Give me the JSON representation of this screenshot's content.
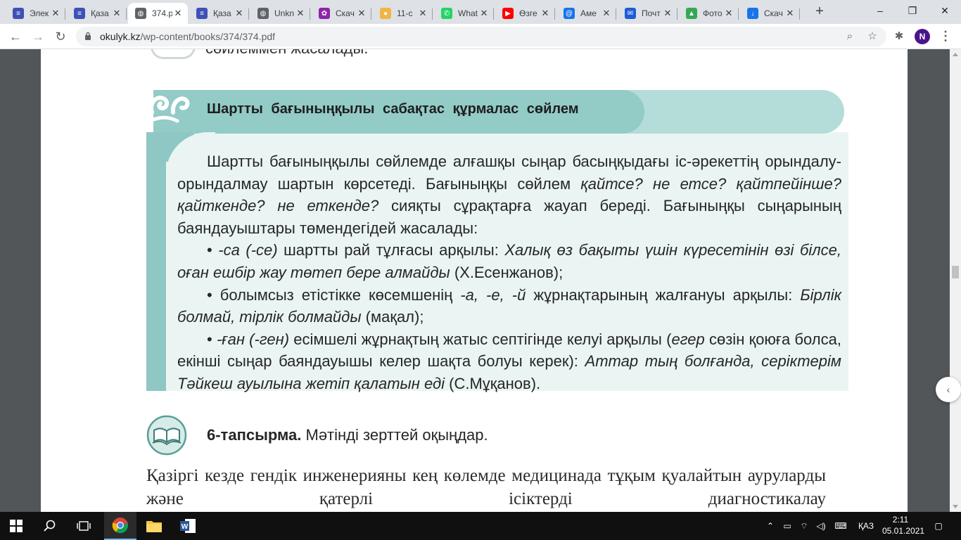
{
  "tabs": [
    {
      "label": "Элек",
      "icon": "book-stack-icon",
      "color": "#3f51b5"
    },
    {
      "label": "Қаза",
      "icon": "book-stack-icon",
      "color": "#3f51b5"
    },
    {
      "label": "374.p",
      "icon": "globe-icon",
      "color": "#5f6368",
      "active": true
    },
    {
      "label": "Қаза",
      "icon": "book-stack-icon",
      "color": "#3f51b5"
    },
    {
      "label": "Unkn",
      "icon": "globe-icon",
      "color": "#5f6368"
    },
    {
      "label": "Скач",
      "icon": "purple-app-icon",
      "color": "#8e24aa"
    },
    {
      "label": "11-с",
      "icon": "coin-icon",
      "color": "#f2b544"
    },
    {
      "label": "What",
      "icon": "whatsapp-icon",
      "color": "#25d366"
    },
    {
      "label": "Өзге",
      "icon": "youtube-icon",
      "color": "#ff0000"
    },
    {
      "label": "Аме",
      "icon": "at-mail-icon",
      "color": "#1a73e8"
    },
    {
      "label": "Почт",
      "icon": "mail-icon",
      "color": "#1e5bd6"
    },
    {
      "label": "Фото",
      "icon": "drive-icon",
      "color": "#34a853"
    },
    {
      "label": "Скач",
      "icon": "download-icon",
      "color": "#1a73e8"
    }
  ],
  "new_tab": "+",
  "window": {
    "minimize": "–",
    "restore": "❐",
    "close": "✕"
  },
  "toolbar": {
    "back": "←",
    "forward": "→",
    "reload": "↻",
    "url_host": "okulyk.kz",
    "url_path": "/wp-content/books/374/374.pdf",
    "avatar_letter": "N"
  },
  "pdf": {
    "cut_text": "сөйлеммен жасалады.",
    "header_title": "Шартты бағыныңқылы сабақтас құрмалас сөйлем",
    "paragraph1_a": "Шартты бағыныңқылы сөйлемде алғашқы сыңар басыңқыдағы іс-әрекеттің орындалу-орындалмау шартын көрсетеді. Бағыныңқы сөйлем ",
    "paragraph1_i": "қайтсе? не етсе? қайтпейінше? қайткенде? не еткенде?",
    "paragraph1_b": " сияқты сұрақтарға жауап береді. Бағыныңқы сыңарының баяндауыштары төмендегідей жасалады:",
    "bullet1_a": "• ",
    "bullet1_i1": "-са (-се)",
    "bullet1_b": " шартты рай тұлғасы арқылы: ",
    "bullet1_i2": "Халық өз бақыты үшін күресетінін өзі білсе, оған ешбір жау төтеп бере алмайды",
    "bullet1_c": " (Х.Есенжанов);",
    "bullet2_a": "• болымсыз етістікке көсемшенің ",
    "bullet2_i1": "-а, -е, -й",
    "bullet2_b": " жұрнақтарының жалғануы арқылы: ",
    "bullet2_i2": "Бірлік болмай, тірлік болмайды",
    "bullet2_c": " (мақал);",
    "bullet3_a": "• ",
    "bullet3_i1": "-ған (-ген)",
    "bullet3_b": " есімшелі жұрнақтың жатыс септігінде келуі арқылы (",
    "bullet3_i2": "егер",
    "bullet3_c": " сөзін қоюға болса, екінші сыңар баяндауышы келер шақта болуы керек): ",
    "bullet3_i3": "Аттар тың болғанда, серіктерім Тәйкеш ауылына жетіп қалатын еді",
    "bullet3_d": " (С.Мұқанов).",
    "task_label": "6-тапсырма.",
    "task_text": " Мәтінді зерттей оқыңдар.",
    "text2": "Қазіргі кезде гендік инженерияны кең көлемде медицинада тұқым қуалайтын ауруларды және қатерлі ісіктерді диагностикалау"
  },
  "taskbar": {
    "language": "ҚАЗ",
    "time": "2:11",
    "date": "05.01.2021"
  }
}
